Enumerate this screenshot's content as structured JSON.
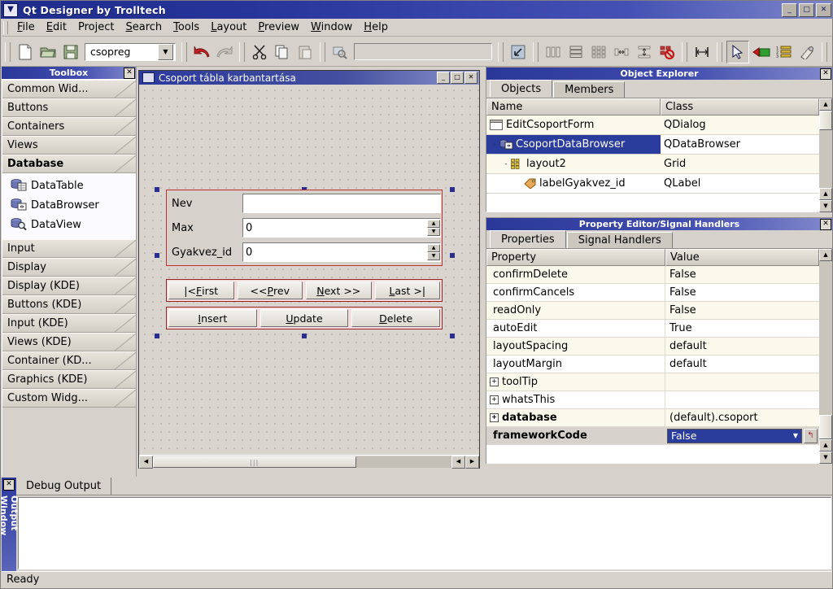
{
  "window": {
    "title": "Qt Designer by Trolltech",
    "sysmenu_icon": "chevron-down-icon",
    "minimize": "_",
    "maximize": "□",
    "close": "✕"
  },
  "menubar": {
    "items": [
      {
        "pre": "",
        "mn": "F",
        "post": "ile"
      },
      {
        "pre": "",
        "mn": "E",
        "post": "dit"
      },
      {
        "pre": "Pro",
        "mn": "j",
        "post": "ect"
      },
      {
        "pre": "",
        "mn": "S",
        "post": "earch"
      },
      {
        "pre": "",
        "mn": "T",
        "post": "ools"
      },
      {
        "pre": "",
        "mn": "L",
        "post": "ayout"
      },
      {
        "pre": "",
        "mn": "P",
        "post": "review"
      },
      {
        "pre": "",
        "mn": "W",
        "post": "indow"
      },
      {
        "pre": "",
        "mn": "H",
        "post": "elp"
      }
    ]
  },
  "toolbar": {
    "project_combo_value": "csopreg",
    "search_placeholder": "",
    "search_value": "",
    "buttons": [
      "new-file-icon",
      "open-folder-icon",
      "save-icon",
      "undo-icon",
      "redo-icon",
      "cut-icon",
      "copy-icon",
      "paste-icon",
      "find-icon",
      "adjust-size-icon",
      "layout-horizontal-icon",
      "layout-vertical-icon",
      "layout-grid-icon",
      "split-horizontal-icon",
      "split-vertical-icon",
      "break-layout-icon",
      "add-spacer-icon",
      "pointer-icon",
      "push-button-icon",
      "list-box-icon",
      "connect-signals-icon",
      "whats-this-icon"
    ]
  },
  "toolbox": {
    "title": "Toolbox",
    "close": "✕",
    "sections_top": [
      "Common Wid...",
      "Buttons",
      "Containers",
      "Views"
    ],
    "active_section": "Database",
    "database_items": [
      {
        "label": "DataTable",
        "icon": "data-table-icon"
      },
      {
        "label": "DataBrowser",
        "icon": "data-browser-icon"
      },
      {
        "label": "DataView",
        "icon": "data-view-icon"
      }
    ],
    "sections_bottom": [
      "Input",
      "Display",
      "Display (KDE)",
      "Buttons (KDE)",
      "Input (KDE)",
      "Views (KDE)",
      "Container (KD...",
      "Graphics (KDE)",
      "Custom Widg..."
    ]
  },
  "form_window": {
    "title": "Csoport tábla karbantartása",
    "minimize": "_",
    "maximize": "□",
    "close": "✕",
    "fields": [
      {
        "label": "Nev",
        "value": "",
        "type": "lineedit"
      },
      {
        "label": "Max",
        "value": "0",
        "type": "spinbox"
      },
      {
        "label": "Gyakvez_id",
        "value": "0",
        "type": "spinbox"
      }
    ],
    "nav_buttons": [
      {
        "pre": "|< ",
        "mn": "F",
        "post": "irst"
      },
      {
        "pre": "<< ",
        "mn": "P",
        "post": "rev"
      },
      {
        "pre": "",
        "mn": "N",
        "post": "ext >>"
      },
      {
        "pre": "",
        "mn": "L",
        "post": "ast >|"
      }
    ],
    "action_buttons": [
      {
        "pre": "",
        "mn": "I",
        "post": "nsert"
      },
      {
        "pre": "",
        "mn": "U",
        "post": "pdate"
      },
      {
        "pre": "",
        "mn": "D",
        "post": "elete"
      }
    ],
    "scroll_left": "◀",
    "scroll_right": "▶"
  },
  "object_explorer": {
    "title": "Object Explorer",
    "close": "✕",
    "tabs": [
      {
        "label": "Objects",
        "selected": true
      },
      {
        "label": "Members",
        "selected": false
      }
    ],
    "columns": [
      "Name",
      "Class"
    ],
    "rows": [
      {
        "name": "EditCsoportForm",
        "class": "QDialog",
        "indent": 0,
        "icon": "form-icon",
        "selected": false,
        "expander": ""
      },
      {
        "name": "CsoportDataBrowser",
        "class": "QDataBrowser",
        "indent": 1,
        "icon": "data-browser-icon",
        "selected": true,
        "expander": "-"
      },
      {
        "name": "layout2",
        "class": "Grid",
        "indent": 2,
        "icon": "grid-layout-icon",
        "selected": false,
        "expander": "-"
      },
      {
        "name": "labelGyakvez_id",
        "class": "QLabel",
        "indent": 3,
        "icon": "label-icon",
        "selected": false,
        "expander": ""
      }
    ],
    "scroll_up": "▲",
    "scroll_down": "▼"
  },
  "property_editor": {
    "title": "Property Editor/Signal Handlers",
    "close": "✕",
    "tabs": [
      {
        "label": "Properties",
        "mn": "r",
        "selected": true
      },
      {
        "label": "Signal Handlers",
        "mn": "l",
        "selected": false
      }
    ],
    "columns": [
      "Property",
      "Value"
    ],
    "rows": [
      {
        "property": "confirmDelete",
        "value": "False",
        "expander": "",
        "bold": false,
        "selected": false
      },
      {
        "property": "confirmCancels",
        "value": "False",
        "expander": "",
        "bold": false,
        "selected": false
      },
      {
        "property": "readOnly",
        "value": "False",
        "expander": "",
        "bold": false,
        "selected": false
      },
      {
        "property": "autoEdit",
        "value": "True",
        "expander": "",
        "bold": false,
        "selected": false
      },
      {
        "property": "layoutSpacing",
        "value": "default",
        "expander": "",
        "bold": false,
        "selected": false
      },
      {
        "property": "layoutMargin",
        "value": "default",
        "expander": "",
        "bold": false,
        "selected": false
      },
      {
        "property": "toolTip",
        "value": "",
        "expander": "+",
        "bold": false,
        "selected": false
      },
      {
        "property": "whatsThis",
        "value": "",
        "expander": "+",
        "bold": false,
        "selected": false
      },
      {
        "property": "database",
        "value": "(default).csoport",
        "expander": "+",
        "bold": true,
        "selected": false
      },
      {
        "property": "frameworkCode",
        "value": "False",
        "expander": "",
        "bold": true,
        "selected": true
      }
    ],
    "revert_icon": "revert-arrow-icon",
    "dropdown_arrow": "▼",
    "scroll_up": "▲",
    "scroll_down": "▼"
  },
  "output_window": {
    "side_title": "Output Window",
    "close": "✕",
    "tabs": [
      {
        "label": "Debug Output",
        "selected": true
      }
    ],
    "content": ""
  },
  "statusbar": {
    "message": "Ready"
  },
  "colors": {
    "titlebar_blue": "#2a3899",
    "selection_blue": "#2a3c9c",
    "panel_face": "#d6d2cb",
    "layout_red": "#c03030",
    "row_alt": "#fbf9ec"
  }
}
